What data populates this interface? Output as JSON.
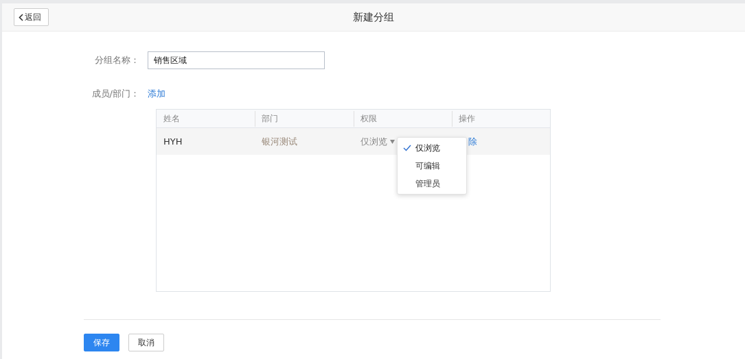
{
  "header": {
    "back_button": "返回",
    "title": "新建分组"
  },
  "form": {
    "name_label": "分组名称：",
    "name_value": "销售区域",
    "members_label": "成员/部门：",
    "add_link": "添加"
  },
  "table": {
    "columns": [
      "姓名",
      "部门",
      "权限",
      "操作"
    ],
    "rows": [
      {
        "name": "HYH",
        "department": "银河测试",
        "permission": "仅浏览",
        "action": "除"
      }
    ]
  },
  "permission_menu": [
    {
      "label": "仅浏览",
      "selected": true
    },
    {
      "label": "可编辑",
      "selected": false
    },
    {
      "label": "管理员",
      "selected": false
    }
  ],
  "buttons": {
    "save": "保存",
    "cancel": "取消"
  }
}
